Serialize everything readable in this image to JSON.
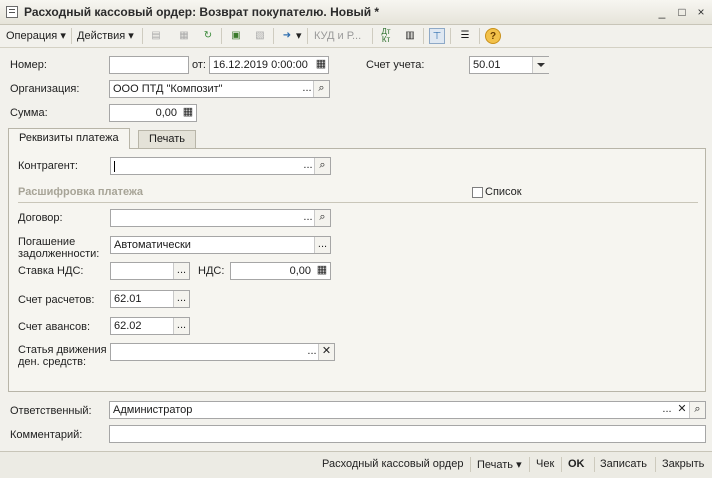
{
  "window": {
    "title": "Расходный кассовый ордер: Возврат покупателю. Новый *",
    "controls": [
      "_",
      "□",
      "×"
    ]
  },
  "toolbar": {
    "operation": "Операция",
    "actions": "Действия",
    "kud": "КУД и Р...",
    "dtkt": "Дт Кт"
  },
  "header": {
    "number_label": "Номер:",
    "number_value": "",
    "date_label": "от:",
    "date_value": "16.12.2019  0:00:00",
    "account_label": "Счет учета:",
    "account_value": "50.01",
    "org_label": "Организация:",
    "org_value": "ООО ПТД \"Композит\"",
    "sum_label": "Сумма:",
    "sum_value": "0,00"
  },
  "tabs": [
    "Реквизиты платежа",
    "Печать"
  ],
  "payment": {
    "counterparty_label": "Контрагент:",
    "counterparty_value": "",
    "section_title": "Расшифровка платежа",
    "list_label": "Список",
    "list_checked": false,
    "contract_label": "Договор:",
    "contract_value": "",
    "repayment_label_1": "Погашение",
    "repayment_label_2": "задолженности:",
    "repayment_value": "Автоматически",
    "vat_rate_label": "Ставка НДС:",
    "vat_rate_value": "",
    "vat_label": "НДС:",
    "vat_value": "0,00",
    "settle_label": "Счет расчетов:",
    "settle_value": "62.01",
    "advance_label": "Счет авансов:",
    "advance_value": "62.02",
    "cashflow_label_1": "Статья движения",
    "cashflow_label_2": "ден. средств:",
    "cashflow_value": ""
  },
  "footer_fields": {
    "responsible_label": "Ответственный:",
    "responsible_value": "Администратор",
    "comment_label": "Комментарий:",
    "comment_value": ""
  },
  "bottom": {
    "print_form": "Расходный кассовый ордер",
    "print": "Печать",
    "check": "Чек",
    "ok": "OK",
    "save": "Записать",
    "close": "Закрыть"
  },
  "colors": {
    "help": "#e0a000",
    "accent": "#2f6fb0"
  }
}
